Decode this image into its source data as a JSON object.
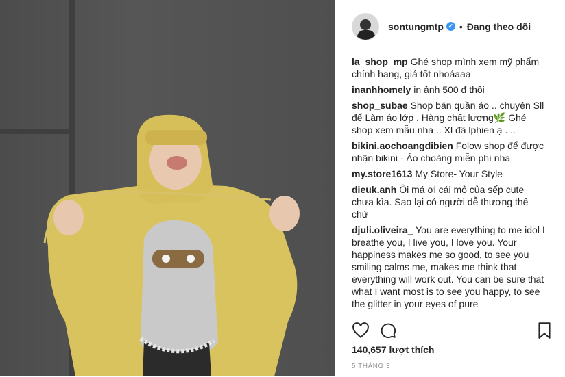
{
  "header": {
    "username": "sontungmtp",
    "separator": "•",
    "follow_status": "Đang theo dõi",
    "verified_glyph": "✓"
  },
  "comments": [
    {
      "user": "la_shop_mp",
      "text": "Ghé shop mình xem mỹ phẩm chính hang, giá tốt nhoáaaa"
    },
    {
      "user": "inanhhomely",
      "text": "in ảnh 500 đ thôi"
    },
    {
      "user": "shop_subae",
      "text": "Shop bán quần áo .. chuyên Sll để Làm áo lớp . Hàng chất lượng",
      "emoji": "🌿",
      "text2": " Ghé shop xem mẫu nha .. Xl đã lphien ạ . .."
    },
    {
      "user": "bikini.aochoangdibien",
      "text": "Folow shop để được nhận bikini - Áo choàng miễn phí nha"
    },
    {
      "user": "my.store1613",
      "text": "My Store- Your Style"
    },
    {
      "user": "dieuk.anh",
      "text": "Ôi má ơi cái mỏ của sếp cute chưa kìa. Sao lại có người dễ thương thế chứ"
    },
    {
      "user": "djuli.oliveira_",
      "text": "You are everything to me idol I breathe you, I live you, I love you. Your happiness makes me so good, to see you smiling calms me, makes me think that everything will work out. You can be sure that what I want most is to see you happy, to see the glitter in your eyes of pure"
    }
  ],
  "actions": {
    "like_icon": "heart-icon",
    "comment_icon": "comment-icon",
    "save_icon": "bookmark-icon",
    "likes_text": "140,657 lượt thích",
    "date_text": "5 THÁNG 3"
  },
  "colors": {
    "verified": "#3897f0",
    "hoodie": "#d9c35e",
    "wall": "#4f4f4f"
  }
}
